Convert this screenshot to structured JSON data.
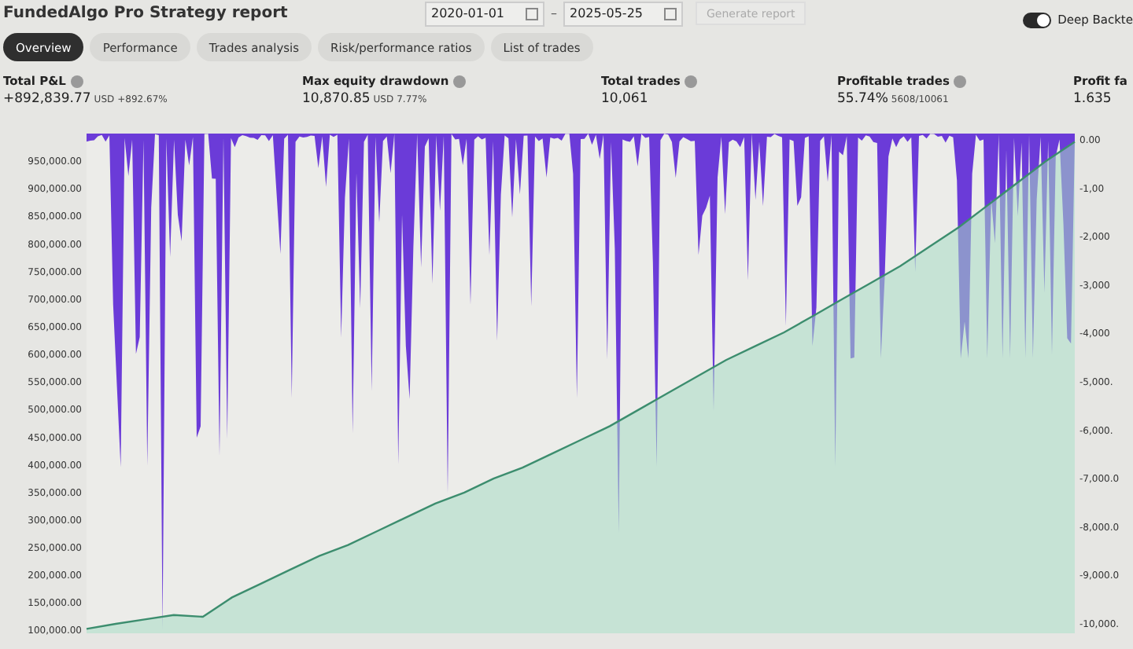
{
  "header": {
    "title": "FundedAlgo Pro Strategy report",
    "start_date": "2020-01-01",
    "separator": "–",
    "end_date": "2025-05-25",
    "generate_button": {
      "label": "Generate report",
      "disabled": true
    },
    "deep_backtest": {
      "label": "Deep Backte",
      "on": true
    }
  },
  "tabs": [
    {
      "label": "Overview",
      "selected": true
    },
    {
      "label": "Performance",
      "selected": false
    },
    {
      "label": "Trades analysis",
      "selected": false
    },
    {
      "label": "Risk/performance ratios",
      "selected": false
    },
    {
      "label": "List of trades",
      "selected": false
    }
  ],
  "stats": [
    {
      "label": "Total P&L",
      "info": true,
      "value": "+892,839.77",
      "unit": "USD",
      "extra": "+892.67%"
    },
    {
      "label": "Max equity drawdown",
      "info": true,
      "value": "10,870.85",
      "unit": "USD",
      "extra": "7.77%"
    },
    {
      "label": "Total trades",
      "info": true,
      "value": "10,061"
    },
    {
      "label": "Profitable trades",
      "info": true,
      "value": "55.74%",
      "extra": "5608/10061"
    },
    {
      "label": "Profit fa",
      "info": false,
      "value": "1.635"
    }
  ],
  "chart": {
    "chart_data": {
      "type": "area",
      "ylim": [
        95000,
        1000000
      ],
      "yticks": [
        {
          "value": 950000,
          "label": "950,000.00"
        },
        {
          "value": 900000,
          "label": "900,000.00"
        },
        {
          "value": 850000,
          "label": "850,000.00"
        },
        {
          "value": 800000,
          "label": "800,000.00"
        },
        {
          "value": 750000,
          "label": "750,000.00"
        },
        {
          "value": 700000,
          "label": "700,000.00"
        },
        {
          "value": 650000,
          "label": "650,000.00"
        },
        {
          "value": 600000,
          "label": "600,000.00"
        },
        {
          "value": 550000,
          "label": "550,000.00"
        },
        {
          "value": 500000,
          "label": "500,000.00"
        },
        {
          "value": 450000,
          "label": "450,000.00"
        },
        {
          "value": 400000,
          "label": "400,000.00"
        },
        {
          "value": 350000,
          "label": "350,000.00"
        },
        {
          "value": 300000,
          "label": "300,000.00"
        },
        {
          "value": 250000,
          "label": "250,000.00"
        },
        {
          "value": 200000,
          "label": "200,000.00"
        },
        {
          "value": 150000,
          "label": "150,000.00"
        },
        {
          "value": 100000,
          "label": "100,000.00"
        }
      ],
      "series": [
        {
          "color": "#3c8d6e",
          "values": [
            103000,
            112000,
            120000,
            128000,
            125000,
            160000,
            185000,
            210000,
            235000,
            255000,
            280000,
            305000,
            330000,
            350000,
            375000,
            395000,
            420000,
            445000,
            470000,
            500000,
            530000,
            560000,
            590000,
            615000,
            640000,
            670000,
            700000,
            730000,
            760000,
            795000,
            830000,
            870000,
            910000,
            950000,
            985000
          ]
        }
      ]
    },
    "right_axis": [
      "0.00",
      "-1,00",
      "-2,000",
      "-3,000",
      "-4,000",
      "-5,000.",
      "-6,000.",
      "-7,000.0",
      "-8,000.0",
      "-9,000.0",
      "-10,000."
    ]
  }
}
